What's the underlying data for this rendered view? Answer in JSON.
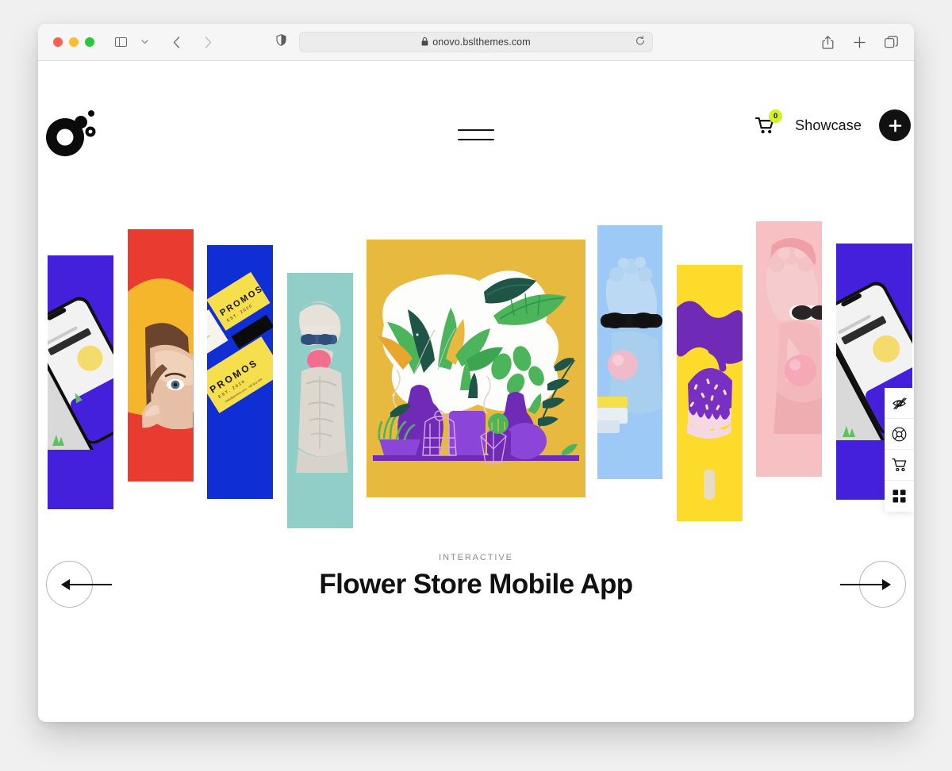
{
  "browser": {
    "url": "onovo.bslthemes.com",
    "lock_icon": "lock-icon",
    "reload_icon": "reload-icon",
    "shield_icon": "privacy-shield-icon",
    "sidebar_icon": "sidebar-toggle-icon",
    "back_icon": "back-arrow-icon",
    "forward_icon": "forward-arrow-icon",
    "share_icon": "share-icon",
    "newtab_icon": "plus-icon",
    "tabs_icon": "tab-overview-icon",
    "traffic": {
      "close": "close-button",
      "minimize": "minimize-button",
      "zoom": "zoom-button"
    }
  },
  "site": {
    "logo_name": "onovo-logo",
    "nav": {
      "menu_toggle_label": "menu-toggle",
      "cart_icon": "cart-icon",
      "cart_count": "0",
      "showcase_label": "Showcase",
      "plus_label": "+"
    },
    "side_toolbar": [
      {
        "icon": "eye-off-icon",
        "name": "hide-ui"
      },
      {
        "icon": "lifebuoy-icon",
        "name": "support"
      },
      {
        "icon": "cart-icon",
        "name": "cart"
      },
      {
        "icon": "grid-icon",
        "name": "grid-view"
      }
    ],
    "carousel": {
      "active_category": "INTERACTIVE",
      "active_title": "Flower Store Mobile App",
      "prev_label": "prev-slide",
      "next_label": "next-slide",
      "slides": [
        {
          "id": 1,
          "name": "slide-phone-surakarta-purple",
          "color": "#4520DC"
        },
        {
          "id": 2,
          "name": "slide-portrait-red-yellow",
          "color": "#EA3B31"
        },
        {
          "id": 3,
          "name": "slide-promos-blue-yellow",
          "color": "#0F2FD5"
        },
        {
          "id": 4,
          "name": "slide-statue-teal",
          "color": "#92CEC8"
        },
        {
          "id": 5,
          "name": "slide-flower-store-yellow",
          "color": "#E8B93F"
        },
        {
          "id": 6,
          "name": "slide-statue-blue",
          "color": "#9CC9F5"
        },
        {
          "id": 7,
          "name": "slide-popsicle-yellow",
          "color": "#FCDB2B"
        },
        {
          "id": 8,
          "name": "slide-statue-pink",
          "color": "#F7C0C2"
        },
        {
          "id": 9,
          "name": "slide-phone-surakarta-purple-2",
          "color": "#4520DC"
        }
      ]
    }
  },
  "colors": {
    "accent_badge": "#d4f028",
    "ink": "#111111",
    "muted": "#8b8b8b"
  }
}
